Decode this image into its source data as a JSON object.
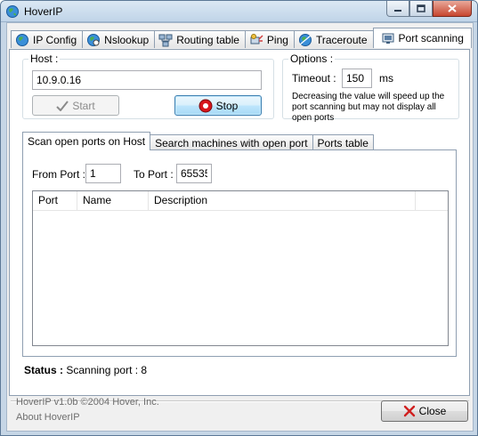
{
  "window": {
    "title": "HoverIP",
    "icon": "globe-icon",
    "controls": [
      "minimize-icon",
      "maximize-icon",
      "close-icon"
    ]
  },
  "tabs": [
    {
      "label": "IP Config",
      "icon": "globe-icon"
    },
    {
      "label": "Nslookup",
      "icon": "globe-icon"
    },
    {
      "label": "Routing table",
      "icon": "network-icon"
    },
    {
      "label": "Ping",
      "icon": "ping-icon"
    },
    {
      "label": "Traceroute",
      "icon": "globe-icon"
    },
    {
      "label": "Port scanning",
      "icon": "port-icon",
      "active": true
    }
  ],
  "host_group": {
    "label": "Host :",
    "value": "10.9.0.16",
    "start_label": "Start",
    "stop_label": "Stop"
  },
  "options_group": {
    "label": "Options :",
    "timeout_label": "Timeout :",
    "timeout_value": "150",
    "timeout_unit": "ms",
    "note": "Decreasing the value will speed up the port scanning but may not display all open ports"
  },
  "inner_tabs": [
    {
      "label": "Scan open ports on Host",
      "active": true
    },
    {
      "label": "Search machines with open port"
    },
    {
      "label": "Ports table"
    }
  ],
  "scan": {
    "from_label": "From Port :",
    "from_value": "1",
    "to_label": "To Port :",
    "to_value": "65535",
    "columns": [
      "Port",
      "Name",
      "Description"
    ]
  },
  "status": {
    "label": "Status :",
    "value": "Scanning port : 8"
  },
  "footer": {
    "version": "HoverIP v1.0b ©2004 Hover, Inc.",
    "about": "About HoverIP",
    "close_label": "Close"
  },
  "colors": {
    "stop_red": "#d8151b",
    "close_x_red": "#d02020",
    "frame_blue": "#c6d6e6"
  }
}
